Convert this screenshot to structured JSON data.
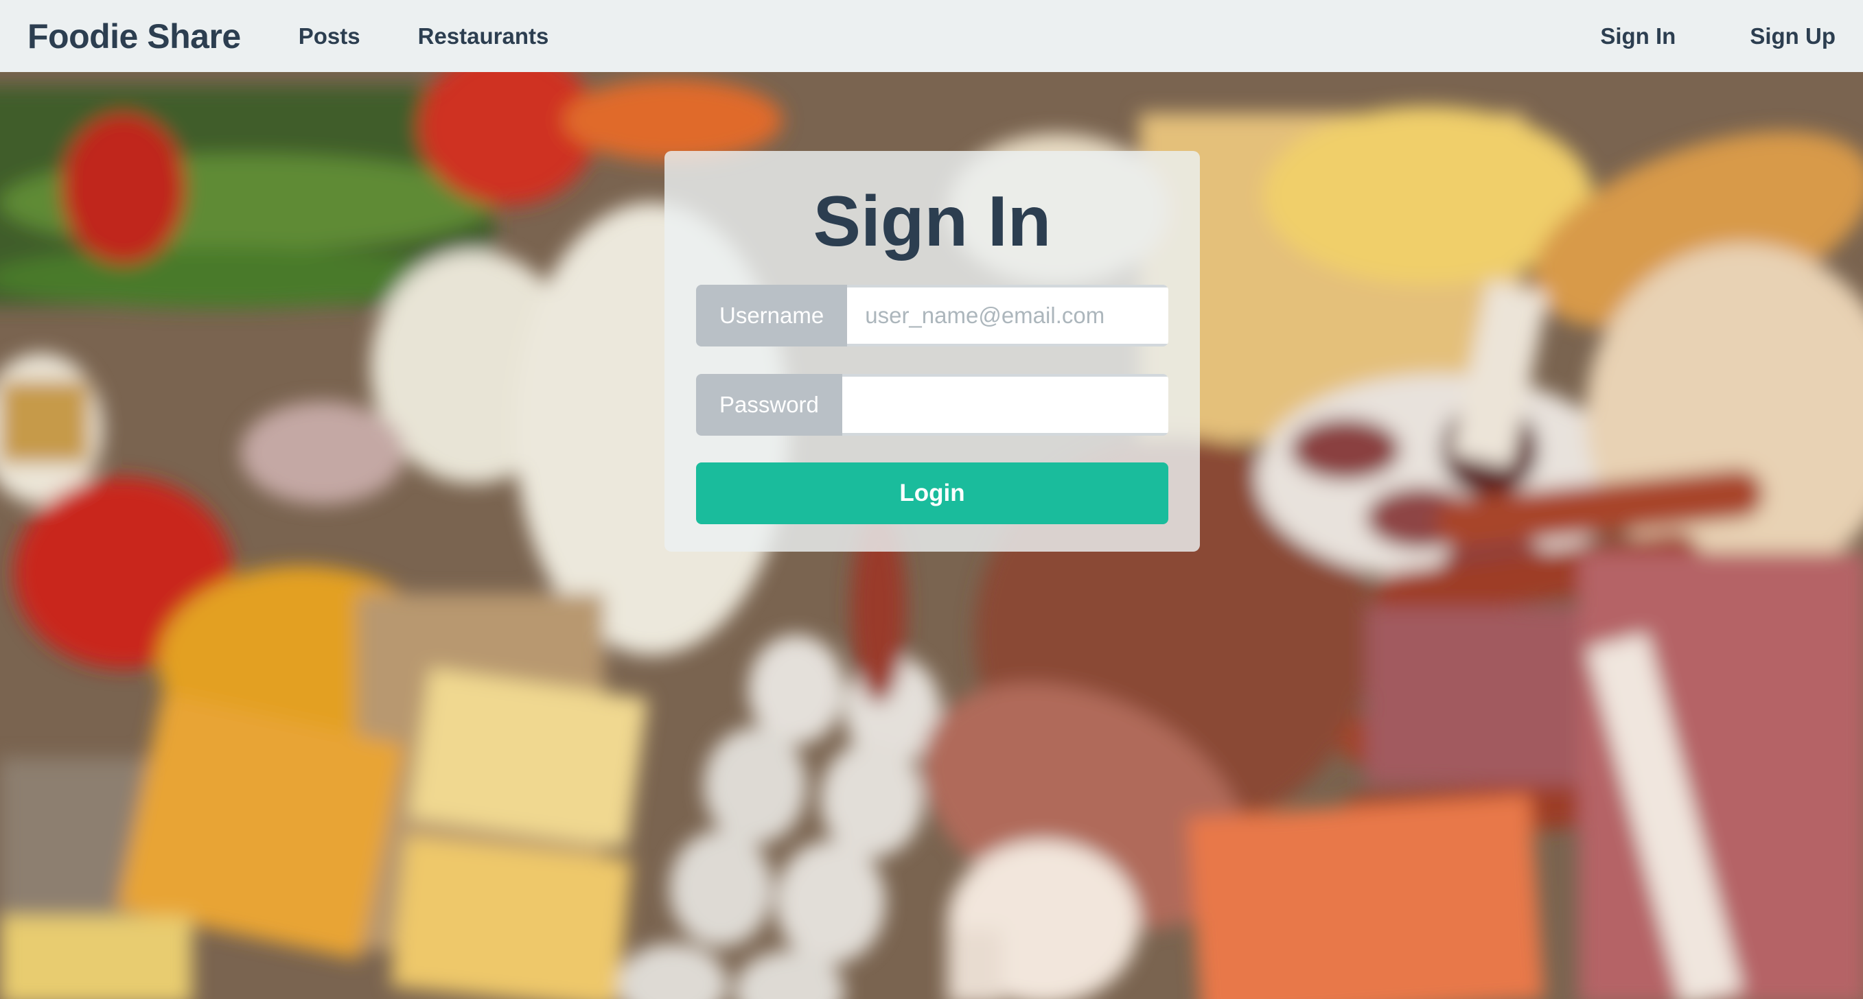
{
  "nav": {
    "brand": "Foodie Share",
    "links": [
      "Posts",
      "Restaurants"
    ],
    "sign_in": "Sign In",
    "sign_up": "Sign Up"
  },
  "form": {
    "title": "Sign In",
    "username_label": "Username",
    "username_placeholder": "user_name@email.com",
    "username_value": "",
    "password_label": "Password",
    "password_value": "",
    "login_label": "Login"
  },
  "colors": {
    "nav_bg": "#ecf0f1",
    "text_dark": "#2c3e50",
    "addon_bg": "#b9c0c6",
    "button": "#1abc9c"
  }
}
